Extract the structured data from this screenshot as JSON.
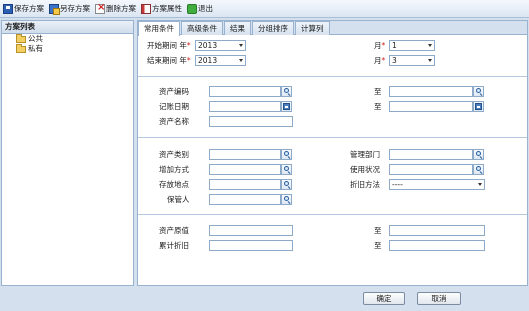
{
  "toolbar": {
    "save": "保存方案",
    "save_as": "另存方案",
    "delete": "删除方案",
    "props": "方案属性",
    "exit": "退出"
  },
  "left_panel": {
    "title": "方案列表",
    "items": [
      "公共",
      "私有"
    ]
  },
  "tabs": [
    "常用条件",
    "高级条件",
    "结果",
    "分组排序",
    "计算列"
  ],
  "form": {
    "start_period_label": "开始期间",
    "year_label": "年",
    "month_label": "月",
    "start_year": "2013",
    "start_month": "1",
    "end_period_label": "结束期间",
    "end_year": "2013",
    "end_month": "3",
    "asset_code": "资产编码",
    "to": "至",
    "booking_date": "记账日期",
    "asset_name": "资产名称",
    "asset_category": "资产类别",
    "management_dept": "管理部门",
    "add_method": "增加方式",
    "usage_status": "使用状况",
    "storage_location": "存放地点",
    "depreciation_method": "折旧方法",
    "depreciation_value": "----",
    "custodian": "保管人",
    "original_value": "资产原值",
    "accumulated_depreciation": "累计折旧"
  },
  "buttons": {
    "ok": "确定",
    "cancel": "取消"
  }
}
